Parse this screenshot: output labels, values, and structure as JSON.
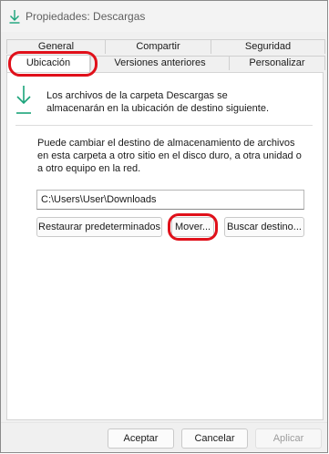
{
  "window": {
    "title": "Propiedades: Descargas",
    "title_icon": "download-arrow-icon"
  },
  "tabs": {
    "row1": [
      {
        "label": "General"
      },
      {
        "label": "Compartir"
      },
      {
        "label": "Seguridad"
      }
    ],
    "row2": [
      {
        "label": "Ubicación",
        "selected": true
      },
      {
        "label": "Versiones anteriores"
      },
      {
        "label": "Personalizar"
      }
    ]
  },
  "location": {
    "info_icon": "download-arrow-icon",
    "info_text": "Los archivos de la carpeta Descargas se almacenarán en la ubicación de destino siguiente.",
    "description": "Puede cambiar el destino de almacenamiento de archivos en esta carpeta a otro sitio en el disco duro, a otra unidad o a otro equipo en la red.",
    "path_value": "C:\\Users\\User\\Downloads",
    "restore_label": "Restaurar predeterminados",
    "move_label": "Mover...",
    "find_label": "Buscar destino..."
  },
  "footer": {
    "ok_label": "Aceptar",
    "cancel_label": "Cancelar",
    "apply_label": "Aplicar"
  },
  "colors": {
    "accent": "#1aa37a",
    "highlight_ring": "#e0101a"
  }
}
